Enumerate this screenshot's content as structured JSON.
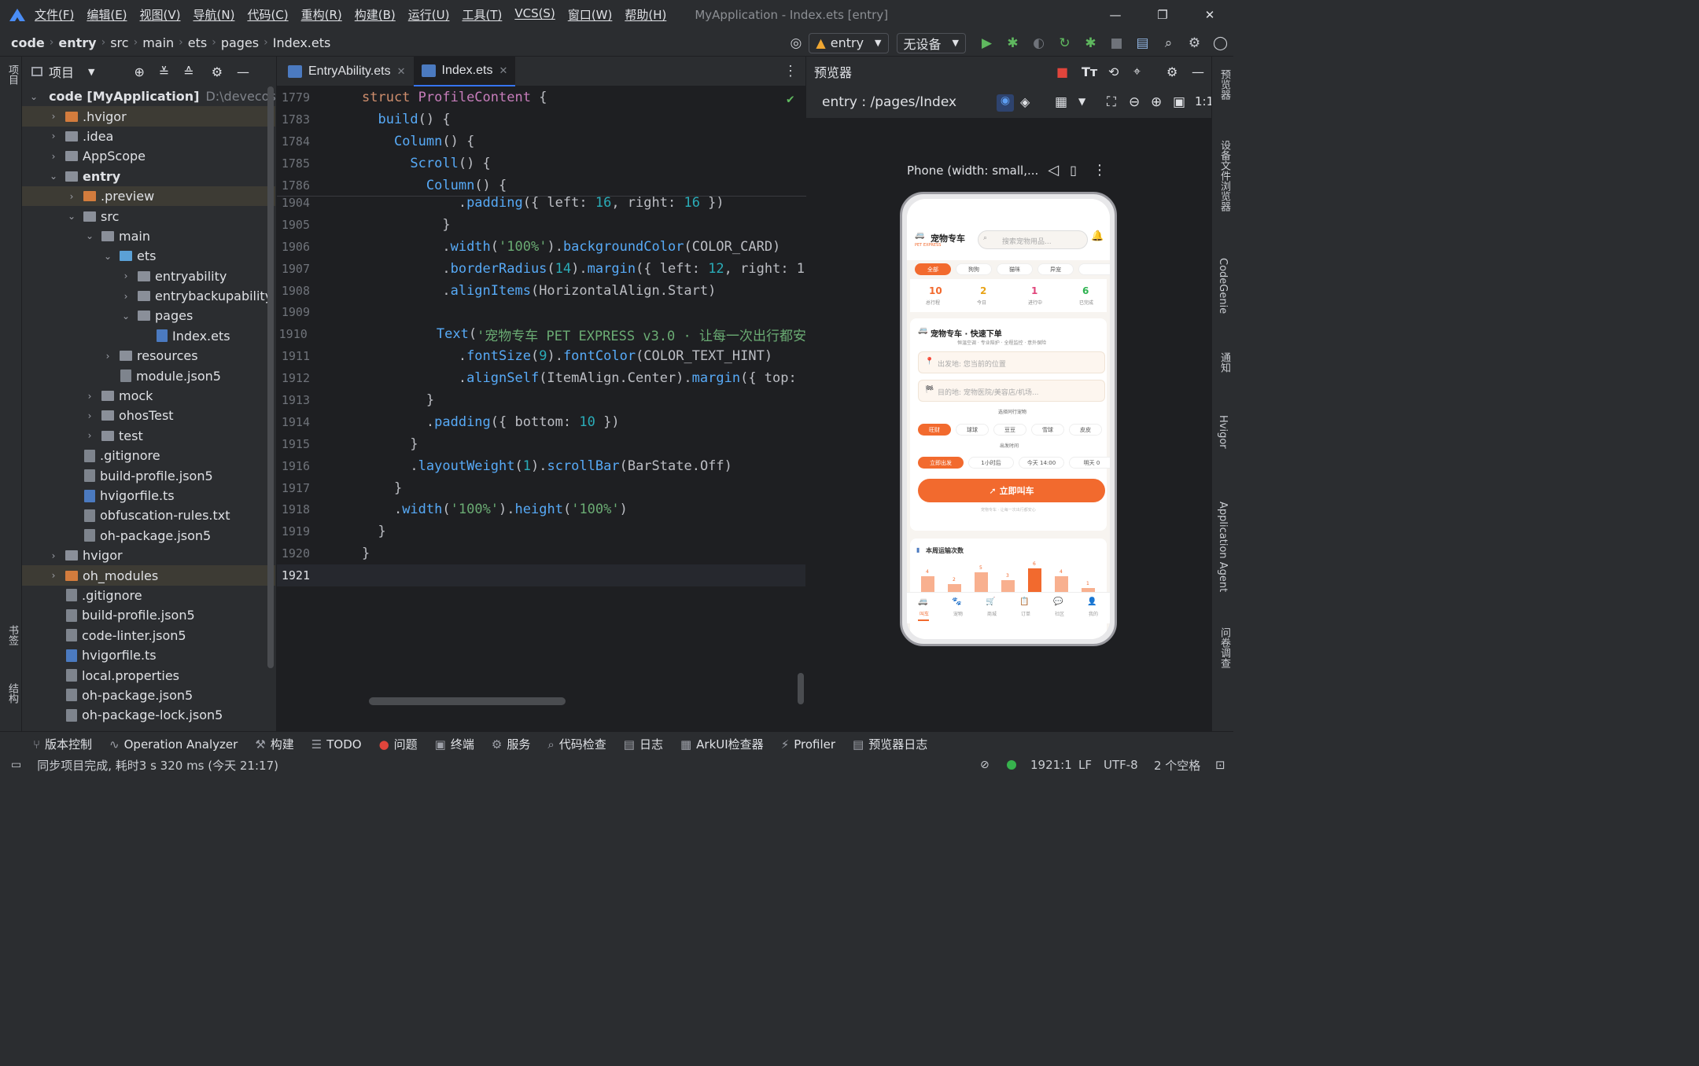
{
  "menu": {
    "items": [
      "文件(F)",
      "编辑(E)",
      "视图(V)",
      "导航(N)",
      "代码(C)",
      "重构(R)",
      "构建(B)",
      "运行(U)",
      "工具(T)",
      "VCS(S)",
      "窗口(W)",
      "帮助(H)"
    ],
    "window_title": "MyApplication - Index.ets [entry]"
  },
  "breadcrumb": [
    "code",
    "entry",
    "src",
    "main",
    "ets",
    "pages",
    "Index.ets"
  ],
  "toolbar": {
    "module": "entry",
    "device": "无设备"
  },
  "project": {
    "title": "项目",
    "tree": [
      {
        "indent": 0,
        "arrow": "⌄",
        "icon": "module",
        "label": "code [MyApplication]",
        "extra": "D:\\devecostu",
        "hl": false
      },
      {
        "indent": 1,
        "arrow": "›",
        "icon": "folder-orange",
        "label": ".hvigor",
        "hl": true
      },
      {
        "indent": 1,
        "arrow": "›",
        "icon": "folder",
        "label": ".idea",
        "hl": false
      },
      {
        "indent": 1,
        "arrow": "›",
        "icon": "folder",
        "label": "AppScope",
        "hl": false
      },
      {
        "indent": 1,
        "arrow": "⌄",
        "icon": "folder",
        "label": "entry",
        "hl": false
      },
      {
        "indent": 2,
        "arrow": "›",
        "icon": "folder-orange",
        "label": ".preview",
        "hl": true
      },
      {
        "indent": 2,
        "arrow": "⌄",
        "icon": "folder",
        "label": "src",
        "hl": false
      },
      {
        "indent": 3,
        "arrow": "⌄",
        "icon": "folder",
        "label": "main",
        "hl": false
      },
      {
        "indent": 4,
        "arrow": "⌄",
        "icon": "folder-blue",
        "label": "ets",
        "hl": false
      },
      {
        "indent": 5,
        "arrow": "›",
        "icon": "folder",
        "label": "entryability",
        "hl": false
      },
      {
        "indent": 5,
        "arrow": "›",
        "icon": "folder",
        "label": "entrybackupability",
        "hl": false
      },
      {
        "indent": 5,
        "arrow": "⌄",
        "icon": "folder",
        "label": "pages",
        "hl": false
      },
      {
        "indent": 6,
        "arrow": "",
        "icon": "ts",
        "label": "Index.ets",
        "hl": false
      },
      {
        "indent": 4,
        "arrow": "›",
        "icon": "folder",
        "label": "resources",
        "hl": false
      },
      {
        "indent": 4,
        "arrow": "",
        "icon": "file",
        "label": "module.json5",
        "hl": false
      },
      {
        "indent": 3,
        "arrow": "›",
        "icon": "folder",
        "label": "mock",
        "hl": false
      },
      {
        "indent": 3,
        "arrow": "›",
        "icon": "folder",
        "label": "ohosTest",
        "hl": false
      },
      {
        "indent": 3,
        "arrow": "›",
        "icon": "folder",
        "label": "test",
        "hl": false
      },
      {
        "indent": 2,
        "arrow": "",
        "icon": "file",
        "label": ".gitignore",
        "hl": false
      },
      {
        "indent": 2,
        "arrow": "",
        "icon": "file",
        "label": "build-profile.json5",
        "hl": false
      },
      {
        "indent": 2,
        "arrow": "",
        "icon": "ts",
        "label": "hvigorfile.ts",
        "hl": false
      },
      {
        "indent": 2,
        "arrow": "",
        "icon": "file",
        "label": "obfuscation-rules.txt",
        "hl": false
      },
      {
        "indent": 2,
        "arrow": "",
        "icon": "file",
        "label": "oh-package.json5",
        "hl": false
      },
      {
        "indent": 1,
        "arrow": "›",
        "icon": "folder",
        "label": "hvigor",
        "hl": false
      },
      {
        "indent": 1,
        "arrow": "›",
        "icon": "folder-orange",
        "label": "oh_modules",
        "hl": true
      },
      {
        "indent": 1,
        "arrow": "",
        "icon": "file",
        "label": ".gitignore",
        "hl": false
      },
      {
        "indent": 1,
        "arrow": "",
        "icon": "file",
        "label": "build-profile.json5",
        "hl": false
      },
      {
        "indent": 1,
        "arrow": "",
        "icon": "file",
        "label": "code-linter.json5",
        "hl": false
      },
      {
        "indent": 1,
        "arrow": "",
        "icon": "ts",
        "label": "hvigorfile.ts",
        "hl": false
      },
      {
        "indent": 1,
        "arrow": "",
        "icon": "file",
        "label": "local.properties",
        "hl": false
      },
      {
        "indent": 1,
        "arrow": "",
        "icon": "file",
        "label": "oh-package.json5",
        "hl": false
      },
      {
        "indent": 1,
        "arrow": "",
        "icon": "file",
        "label": "oh-package-lock.json5",
        "hl": false
      }
    ]
  },
  "tabs": [
    {
      "label": "EntryAbility.ets",
      "active": false
    },
    {
      "label": "Index.ets",
      "active": true
    }
  ],
  "sticky": [
    {
      "n": "1779",
      "t": [
        [
          "kw",
          "struct "
        ],
        [
          "cls",
          "ProfileContent"
        ],
        [
          "plain",
          " {"
        ]
      ]
    },
    {
      "n": "1783",
      "t": [
        [
          "plain",
          "  "
        ],
        [
          "fn",
          "build"
        ],
        [
          "plain",
          "() {"
        ]
      ]
    },
    {
      "n": "1784",
      "t": [
        [
          "plain",
          "    "
        ],
        [
          "fn",
          "Column"
        ],
        [
          "plain",
          "() {"
        ]
      ]
    },
    {
      "n": "1785",
      "t": [
        [
          "plain",
          "      "
        ],
        [
          "fn",
          "Scroll"
        ],
        [
          "plain",
          "() {"
        ]
      ]
    },
    {
      "n": "1786",
      "t": [
        [
          "plain",
          "        "
        ],
        [
          "fn",
          "Column"
        ],
        [
          "plain",
          "() {"
        ]
      ]
    }
  ],
  "code": [
    {
      "n": "1904",
      "t": [
        [
          "plain",
          "            ."
        ],
        [
          "fn",
          "padding"
        ],
        [
          "plain",
          "({ left: "
        ],
        [
          "num",
          "16"
        ],
        [
          "plain",
          ", right: "
        ],
        [
          "num",
          "16"
        ],
        [
          "plain",
          " })"
        ]
      ]
    },
    {
      "n": "1905",
      "t": [
        [
          "plain",
          "          }"
        ]
      ]
    },
    {
      "n": "1906",
      "t": [
        [
          "plain",
          "          ."
        ],
        [
          "fn",
          "width"
        ],
        [
          "plain",
          "("
        ],
        [
          "str",
          "'100%'"
        ],
        [
          "plain",
          ")."
        ],
        [
          "fn",
          "backgroundColor"
        ],
        [
          "plain",
          "(COLOR_CARD)"
        ]
      ]
    },
    {
      "n": "1907",
      "t": [
        [
          "plain",
          "          ."
        ],
        [
          "fn",
          "borderRadius"
        ],
        [
          "plain",
          "("
        ],
        [
          "num",
          "14"
        ],
        [
          "plain",
          ")."
        ],
        [
          "fn",
          "margin"
        ],
        [
          "plain",
          "({ left: "
        ],
        [
          "num",
          "12"
        ],
        [
          "plain",
          ", right: 1"
        ]
      ]
    },
    {
      "n": "1908",
      "t": [
        [
          "plain",
          "          ."
        ],
        [
          "fn",
          "alignItems"
        ],
        [
          "plain",
          "(HorizontalAlign.Start)"
        ]
      ]
    },
    {
      "n": "1909",
      "t": [
        [
          "plain",
          ""
        ]
      ]
    },
    {
      "n": "1910",
      "t": [
        [
          "plain",
          "          "
        ],
        [
          "fn",
          "Text"
        ],
        [
          "plain",
          "("
        ],
        [
          "str",
          "'宠物专车 PET EXPRESS v3.0 · 让每一次出行都安"
        ]
      ]
    },
    {
      "n": "1911",
      "t": [
        [
          "plain",
          "            ."
        ],
        [
          "fn",
          "fontSize"
        ],
        [
          "plain",
          "("
        ],
        [
          "num",
          "9"
        ],
        [
          "plain",
          ")."
        ],
        [
          "fn",
          "fontColor"
        ],
        [
          "plain",
          "(COLOR_TEXT_HINT)"
        ]
      ]
    },
    {
      "n": "1912",
      "t": [
        [
          "plain",
          "            ."
        ],
        [
          "fn",
          "alignSelf"
        ],
        [
          "plain",
          "(ItemAlign.Center)."
        ],
        [
          "fn",
          "margin"
        ],
        [
          "plain",
          "({ top:"
        ]
      ]
    },
    {
      "n": "1913",
      "t": [
        [
          "plain",
          "        }"
        ]
      ]
    },
    {
      "n": "1914",
      "t": [
        [
          "plain",
          "        ."
        ],
        [
          "fn",
          "padding"
        ],
        [
          "plain",
          "({ bottom: "
        ],
        [
          "num",
          "10"
        ],
        [
          "plain",
          " })"
        ]
      ]
    },
    {
      "n": "1915",
      "t": [
        [
          "plain",
          "      }"
        ]
      ]
    },
    {
      "n": "1916",
      "t": [
        [
          "plain",
          "      ."
        ],
        [
          "fn",
          "layoutWeight"
        ],
        [
          "plain",
          "("
        ],
        [
          "num",
          "1"
        ],
        [
          "plain",
          ")."
        ],
        [
          "fn",
          "scrollBar"
        ],
        [
          "plain",
          "(BarState.Off)"
        ]
      ]
    },
    {
      "n": "1917",
      "t": [
        [
          "plain",
          "    }"
        ]
      ]
    },
    {
      "n": "1918",
      "t": [
        [
          "plain",
          "    ."
        ],
        [
          "fn",
          "width"
        ],
        [
          "plain",
          "("
        ],
        [
          "str",
          "'100%'"
        ],
        [
          "plain",
          ")."
        ],
        [
          "fn",
          "height"
        ],
        [
          "plain",
          "("
        ],
        [
          "str",
          "'100%'"
        ],
        [
          "plain",
          ")"
        ]
      ]
    },
    {
      "n": "1919",
      "t": [
        [
          "plain",
          "  }"
        ]
      ]
    },
    {
      "n": "1920",
      "t": [
        [
          "plain",
          "}"
        ]
      ]
    },
    {
      "n": "1921",
      "t": [
        [
          "plain",
          ""
        ]
      ]
    }
  ],
  "previewer": {
    "title": "预览器",
    "route": "entry : /pages/Index",
    "device_label": "Phone (width: small,..."
  },
  "app": {
    "brand": "宠物专车",
    "brand_sub": "PET EXPRESS",
    "search_placeholder": "搜索宠物用品...",
    "filters": [
      "全部",
      "狗狗",
      "猫咪",
      "异宠",
      ""
    ],
    "stats": [
      {
        "value": "10",
        "label": "总行程",
        "color": "#f26a2e"
      },
      {
        "value": "2",
        "label": "今日",
        "color": "#e8a317"
      },
      {
        "value": "1",
        "label": "进行中",
        "color": "#e0457b"
      },
      {
        "value": "6",
        "label": "已完成",
        "color": "#2fb351"
      }
    ],
    "order_title": "宠物专车 · 快速下单",
    "order_sub": "恒温空调 · 专业陪护 · 全程监控 · 意外保险",
    "from_placeholder": "出发地: 您当前的位置",
    "to_placeholder": "目的地: 宠物医院/美容店/机场...",
    "pet_label": "选择同行宠物",
    "pets": [
      "旺财",
      "球球",
      "豆豆",
      "雪球",
      "皮皮"
    ],
    "time_label": "出发时间",
    "times": [
      "立即出发",
      "1小时后",
      "今天 14:00",
      "明天 0"
    ],
    "call_button": "立即叫车",
    "call_hint": "宠物专车 · 让每一次出行都安心",
    "chart_title": "本周运输次数",
    "nav": [
      "叫车",
      "宠物",
      "商城",
      "订单",
      "社区",
      "我的"
    ]
  },
  "chart_data": {
    "type": "bar",
    "title": "本周运输次数",
    "values": [
      4,
      2,
      5,
      3,
      6,
      4,
      1
    ],
    "ylim": [
      0,
      6
    ]
  },
  "bottom_tools": [
    "版本控制",
    "Operation Analyzer",
    "构建",
    "TODO",
    "问题",
    "终端",
    "服务",
    "代码检查",
    "日志",
    "ArkUI检查器",
    "Profiler",
    "预览器日志"
  ],
  "status": {
    "message": "同步项目完成, 耗时3 s 320 ms (今天 21:17)",
    "position": "1921:1",
    "line_sep": "LF",
    "encoding": "UTF-8",
    "indent": "2 个空格"
  },
  "left_strip": {
    "top": "项目",
    "bookmarks": "书签",
    "structure": "结构"
  },
  "right_strip": [
    "预览器",
    "设备文件浏览器",
    "CodeGenie",
    "通知",
    "Hvigor",
    "Application Agent",
    "问卷调查"
  ]
}
